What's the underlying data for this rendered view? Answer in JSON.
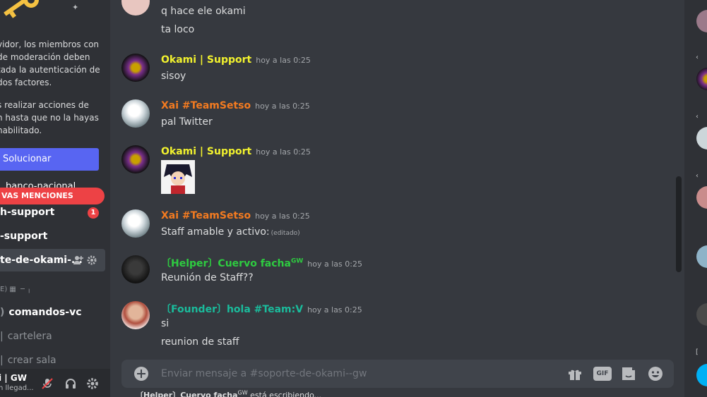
{
  "sidebar": {
    "notice_lines": [
      "vidor, los miembros con",
      "de moderación deben",
      "tada la autenticación de",
      "dos factores."
    ],
    "notice_lines_2": [
      "s realizar acciones de",
      "n hasta que no la hayas",
      " habilitado."
    ],
    "fix_button": "Solucionar",
    "mentions_pill": "VAS MENCIONES",
    "channel_behind": "banco-nacional",
    "channels": [
      {
        "label": "h-support",
        "unread": "1"
      },
      {
        "label": "-support"
      },
      {
        "label": "te-de-okami-..."
      }
    ],
    "category": "E) ▦ ╶╴╷",
    "voice_channels": [
      "comandos-vc",
      "cartelera",
      "crear sala"
    ],
    "user": {
      "name": "i | GW",
      "status": "n llegad..."
    }
  },
  "messages": [
    {
      "lines": [
        "q hace ele okami",
        "ta loco"
      ]
    },
    {
      "author": "Okami | Support",
      "author_color": "#f2f22e",
      "ts": "hoy a las 0:25",
      "lines": [
        "sisoy"
      ]
    },
    {
      "author": "Xai #TeamSetso",
      "author_color": "#f47b20",
      "ts": "hoy a las 0:25",
      "lines": [
        "pal Twitter"
      ]
    },
    {
      "author": "Okami | Support",
      "author_color": "#f2f22e",
      "ts": "hoy a las 0:25",
      "lines": []
    },
    {
      "author": "Xai #TeamSetso",
      "author_color": "#f47b20",
      "ts": "hoy a las 0:25",
      "lines": [
        "Staff amable y activo:"
      ],
      "edited": "(editado)"
    },
    {
      "author": "〔Helper〕Cuervo facha",
      "author_sup": "GW",
      "author_color": "#2ecc40",
      "ts": "hoy a las 0:25",
      "lines": [
        "Reunión de Staff??"
      ]
    },
    {
      "author": "〔Founder〕hola #Team:V",
      "author_color": "#1abc9c",
      "ts": "hoy a las 0:25",
      "lines": [
        "si",
        "reunion de staff"
      ]
    }
  ],
  "composer": {
    "placeholder": "Enviar mensaje a #soporte-de-okami--gw",
    "gif_label": "GIF"
  },
  "typing": "〔Helper〕Cuervo facha",
  "typing_sup": "GW",
  "typing_suffix": " está escribiendo...",
  "members": {
    "bracket": "["
  },
  "colors": {
    "accent": "#5865f2",
    "danger": "#ed4245",
    "bg": "#36393f",
    "sidebar": "#2f3136"
  }
}
